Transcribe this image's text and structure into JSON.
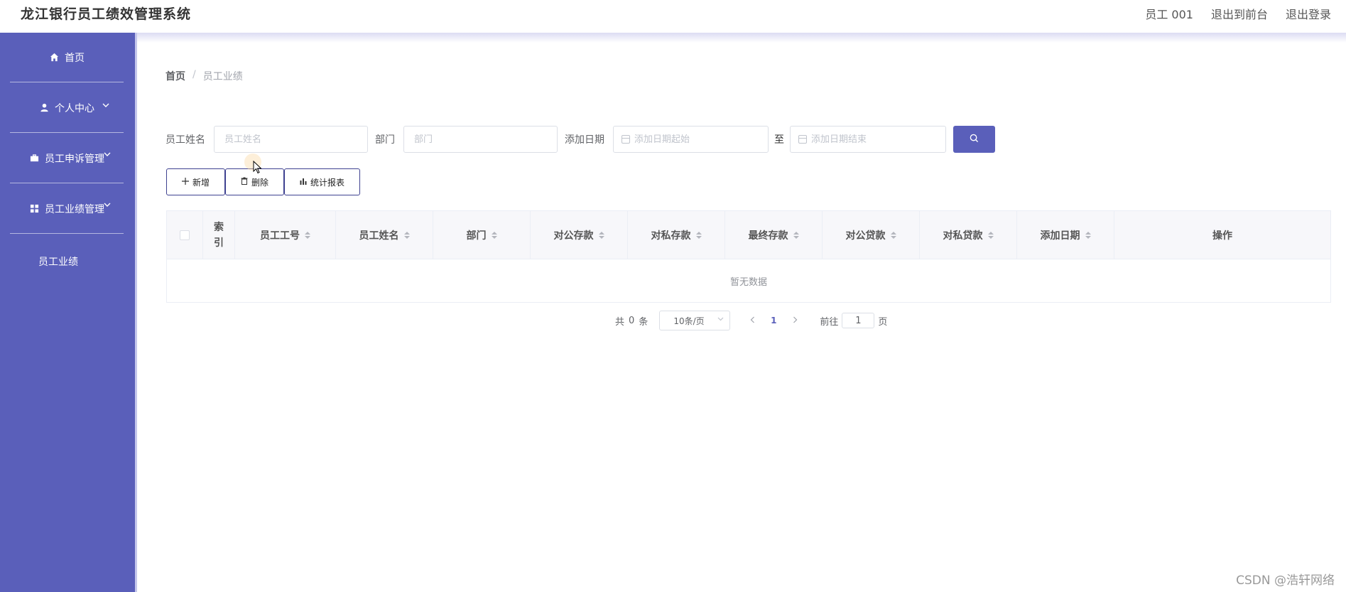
{
  "header": {
    "title": "龙江银行员工绩效管理系统",
    "user_label": "员工 001",
    "back_to_front": "退出到前台",
    "logout": "退出登录"
  },
  "sidebar": {
    "items": [
      {
        "label": "首页",
        "icon": "home-icon"
      },
      {
        "label": "个人中心",
        "icon": "user-icon"
      },
      {
        "label": "员工申诉管理",
        "icon": "briefcase-icon"
      },
      {
        "label": "员工业绩管理",
        "icon": "grid-icon"
      }
    ],
    "sub_item": "员工业绩"
  },
  "breadcrumb": {
    "home": "首页",
    "separator": "/",
    "current": "员工业绩"
  },
  "search": {
    "name_label": "员工姓名",
    "name_placeholder": "员工姓名",
    "dept_label": "部门",
    "dept_placeholder": "部门",
    "date_label": "添加日期",
    "date_start_placeholder": "添加日期起始",
    "date_sep": "至",
    "date_end_placeholder": "添加日期结束"
  },
  "actions": {
    "add": "新增",
    "delete": "删除",
    "report": "统计报表"
  },
  "table": {
    "index_header": "索引",
    "columns": [
      "员工工号",
      "员工姓名",
      "部门",
      "对公存款",
      "对私存款",
      "最终存款",
      "对公贷款",
      "对私贷款",
      "添加日期"
    ],
    "ops_header": "操作",
    "empty_text": "暂无数据"
  },
  "pagination": {
    "total_prefix": "共",
    "total": "0",
    "total_suffix": "条",
    "page_size": "10条/页",
    "current_page": "1",
    "goto_prefix": "前往",
    "goto_value": "1",
    "goto_suffix": "页"
  },
  "watermark": "CSDN @浩轩网络",
  "colors": {
    "sidebar": "#5a5fba",
    "primary": "#5a5fba"
  }
}
